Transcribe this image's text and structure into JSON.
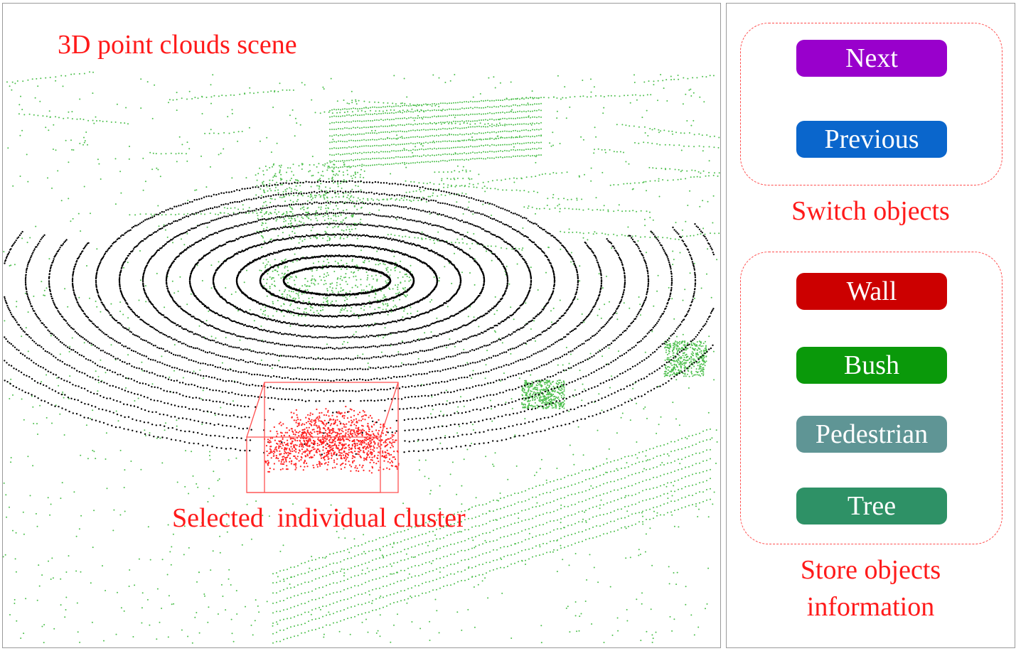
{
  "scene": {
    "title": "3D point clouds scene",
    "cluster_caption": "Selected  individual cluster",
    "colors": {
      "ground_rings": "#000000",
      "vegetation": "#4cbf4c",
      "selected_cluster": "#ff2020"
    }
  },
  "switch_group": {
    "label": "Switch objects",
    "buttons": [
      {
        "label": "Next",
        "color": "#9900cc"
      },
      {
        "label": "Previous",
        "color": "#0a66cc"
      }
    ]
  },
  "store_group": {
    "label_line1": "Store objects",
    "label_line2": "information",
    "buttons": [
      {
        "label": "Wall",
        "color": "#cc0000"
      },
      {
        "label": "Bush",
        "color": "#0a990a"
      },
      {
        "label": "Pedestrian",
        "color": "#5f9595"
      },
      {
        "label": "Tree",
        "color": "#2e9166"
      }
    ]
  }
}
